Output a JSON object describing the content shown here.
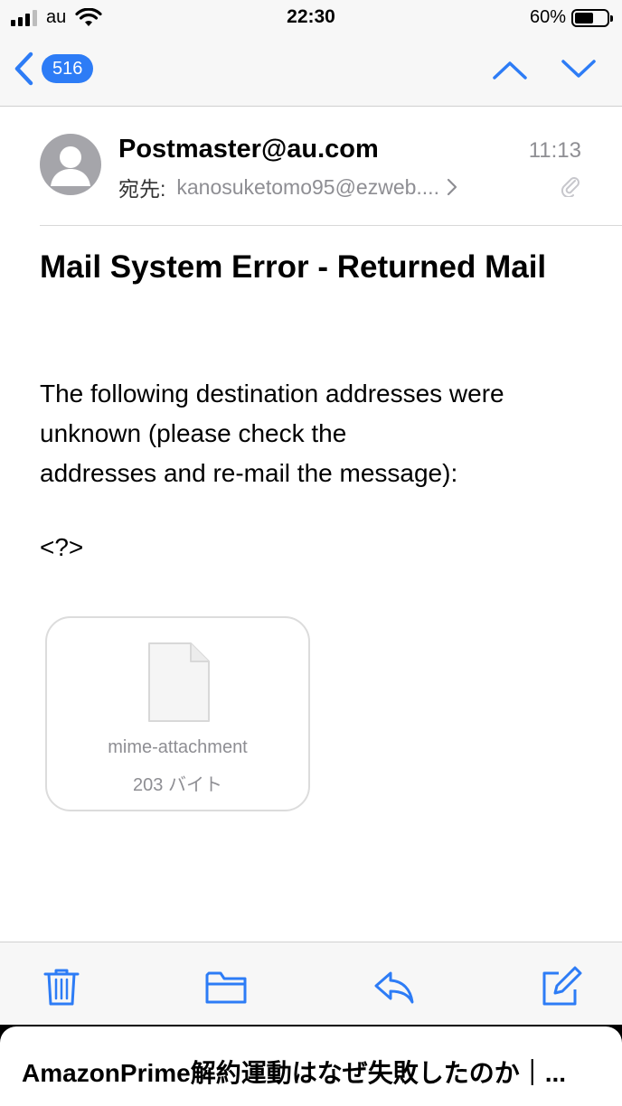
{
  "status_bar": {
    "carrier": "au",
    "time": "22:30",
    "battery_percent": "60%",
    "battery_level": 0.6,
    "signal_icon": "signal-bars-icon",
    "wifi_icon": "wifi-icon"
  },
  "nav": {
    "unread_count": "516",
    "back_icon": "chevron-left-icon",
    "prev_icon": "chevron-up-icon",
    "next_icon": "chevron-down-icon",
    "accent_color": "#2d7cf6"
  },
  "message": {
    "sender": "Postmaster@au.com",
    "time": "11:13",
    "to_label": "宛先:",
    "to_address": "kanosuketomo95@ezweb....",
    "subject": "Mail System Error - Returned Mail",
    "body_lines": [
      "The following destination addresses were",
      "unknown (please check the",
      "addresses and re-mail the message):"
    ],
    "placeholder": "<?>"
  },
  "attachment": {
    "name": "mime-attachment",
    "size": "203 バイト"
  },
  "toolbar": {
    "icons": [
      "trash-icon",
      "folder-icon",
      "reply-icon",
      "compose-icon"
    ]
  },
  "banner": {
    "text": "AmazonPrime解約運動はなぜ失敗したのか｜..."
  }
}
